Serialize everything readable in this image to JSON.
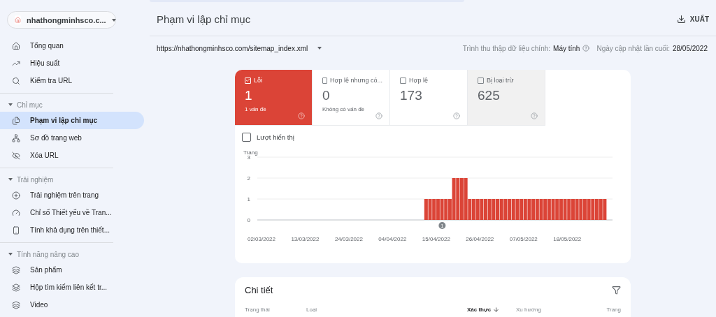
{
  "property": {
    "name": "nhathongminhsco.c..."
  },
  "sidebar": {
    "groups": [
      {
        "items": [
          {
            "label": "Tổng quan",
            "selected": false
          },
          {
            "label": "Hiệu suất",
            "selected": false
          },
          {
            "label": "Kiểm tra URL",
            "selected": false
          }
        ]
      },
      {
        "title": "Chỉ mục",
        "expanded": true,
        "items": [
          {
            "label": "Phạm vi lập chỉ mục",
            "selected": true
          },
          {
            "label": "Sơ đồ trang web",
            "selected": false
          },
          {
            "label": "Xóa URL",
            "selected": false
          }
        ]
      },
      {
        "title": "Trải nghiệm",
        "expanded": true,
        "items": [
          {
            "label": "Trải nghiệm trên trang",
            "selected": false
          },
          {
            "label": "Chỉ số Thiết yếu về Tran...",
            "selected": false
          },
          {
            "label": "Tính khả dụng trên thiết...",
            "selected": false
          }
        ]
      },
      {
        "title": "Tính năng nâng cao",
        "expanded": true,
        "items": [
          {
            "label": "Sản phẩm",
            "selected": false
          },
          {
            "label": "Hộp tìm kiếm liên kết tr...",
            "selected": false
          },
          {
            "label": "Video",
            "selected": false
          }
        ]
      }
    ]
  },
  "header": {
    "title": "Phạm vi lập chỉ mục",
    "export_label": "XUẤT"
  },
  "filter_bar": {
    "sitemap": "https://nhathongminhsco.com/sitemap_index.xml",
    "crawler_label": "Trình thu thập dữ liệu chính:",
    "crawler_value": "Máy tính",
    "updated_label": "Ngày cập nhật lần cuối:",
    "updated_value": "28/05/2022"
  },
  "tiles": [
    {
      "kind": "error",
      "label": "Lỗi",
      "value": "1",
      "note": "1 vấn đề",
      "selected": true
    },
    {
      "kind": "warning",
      "label": "Hợp lệ nhưng có...",
      "value": "0",
      "note": "Không có vấn đề",
      "selected": false
    },
    {
      "kind": "valid",
      "label": "Hợp lệ",
      "value": "173",
      "selected": false
    },
    {
      "kind": "excluded",
      "label": "Bị loại trừ",
      "value": "625",
      "selected": false
    }
  ],
  "impressions": {
    "label": "Lượt hiển thị",
    "checked": false
  },
  "chart": {
    "chart_data": {
      "type": "bar",
      "ylabel": "Trang",
      "ylim": [
        0,
        3
      ],
      "yticks": [
        0,
        1,
        2,
        3
      ],
      "categories": [
        "02/03/2022",
        null,
        null,
        null,
        null,
        null,
        null,
        null,
        null,
        null,
        null,
        "13/03/2022",
        null,
        null,
        null,
        null,
        null,
        null,
        null,
        null,
        null,
        null,
        "24/03/2022",
        null,
        null,
        null,
        null,
        null,
        null,
        null,
        null,
        null,
        null,
        "04/04/2022",
        null,
        null,
        null,
        null,
        null,
        null,
        null,
        null,
        null,
        null,
        "15/04/2022",
        null,
        null,
        null,
        null,
        null,
        null,
        null,
        null,
        null,
        null,
        "26/04/2022",
        null,
        null,
        null,
        null,
        null,
        null,
        null,
        null,
        null,
        null,
        "07/05/2022",
        null,
        null,
        null,
        null,
        null,
        null,
        null,
        null,
        null,
        null,
        "18/05/2022",
        null,
        null,
        null,
        null,
        null,
        null,
        null,
        null,
        null
      ],
      "series": [
        {
          "color": "#db4437",
          "values": [
            0,
            0,
            0,
            0,
            0,
            0,
            0,
            0,
            0,
            0,
            0,
            0,
            0,
            0,
            0,
            0,
            0,
            0,
            0,
            0,
            0,
            0,
            0,
            0,
            0,
            0,
            0,
            0,
            0,
            0,
            0,
            0,
            0,
            0,
            0,
            0,
            0,
            0,
            0,
            0,
            0,
            1,
            1,
            1,
            1,
            1,
            1,
            1,
            2,
            2,
            2,
            2,
            1,
            1,
            1,
            1,
            1,
            1,
            1,
            1,
            1,
            1,
            1,
            1,
            1,
            1,
            1,
            1,
            1,
            1,
            1,
            1,
            1,
            1,
            1,
            1,
            1,
            1,
            1,
            1,
            1,
            1,
            1,
            1,
            1,
            1,
            1
          ]
        }
      ],
      "annotations": [
        "1"
      ]
    }
  },
  "details": {
    "title": "Chi tiết",
    "columns": [
      {
        "label": "Trạng thái",
        "sorted": false
      },
      {
        "label": "Loại",
        "sorted": false
      },
      {
        "label": "Xác thực",
        "sorted": true
      },
      {
        "label": "Xu hướng",
        "sorted": false
      },
      {
        "label": "Trang",
        "sorted": false
      }
    ]
  }
}
